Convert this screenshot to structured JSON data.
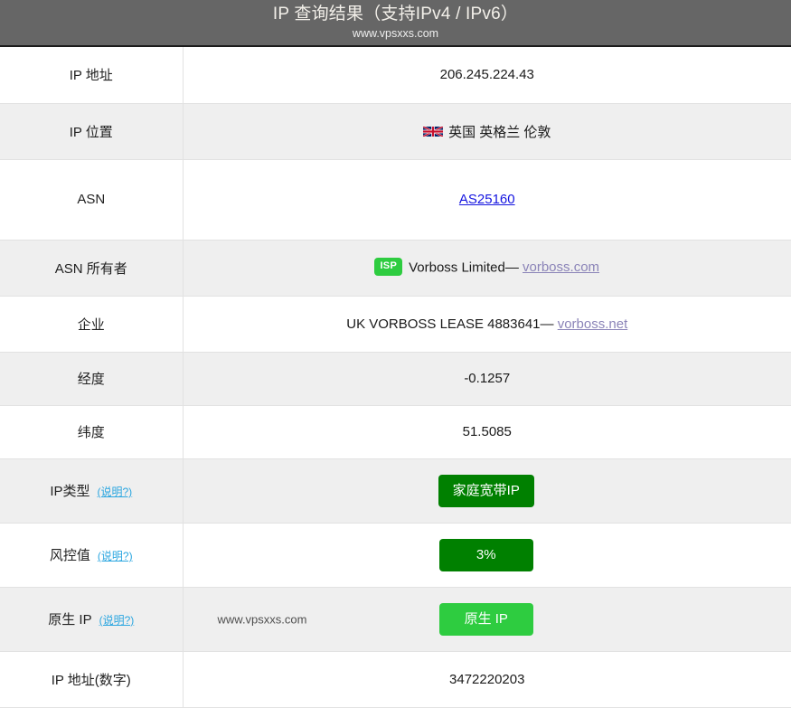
{
  "header": {
    "title": "IP 查询结果（支持IPv4 / IPv6）",
    "subtitle": "www.vpsxxs.com"
  },
  "help_label": "(说明?)",
  "watermark": "www.vpsxxs.com",
  "colors": {
    "header_bg": "#666666",
    "row_alt_bg": "#efefef",
    "badge_dark_green": "#008000",
    "badge_green": "#2ecc40",
    "link_blue": "#1515e0",
    "link_visited": "#8b84b8",
    "help_link_blue": "#2ba6e0"
  },
  "rows": {
    "ip_address": {
      "label": "IP 地址",
      "value": "206.245.224.43"
    },
    "ip_location": {
      "label": "IP 位置",
      "flag": "uk-flag-icon",
      "value": "英国 英格兰 伦敦"
    },
    "asn": {
      "label": "ASN",
      "value": "AS25160"
    },
    "asn_owner": {
      "label": "ASN 所有者",
      "badge": "ISP",
      "value": "Vorboss Limited—",
      "link": "vorboss.com"
    },
    "enterprise": {
      "label": "企业",
      "value": "UK VORBOSS LEASE 4883641—",
      "link": "vorboss.net"
    },
    "longitude": {
      "label": "经度",
      "value": "-0.1257"
    },
    "latitude": {
      "label": "纬度",
      "value": "51.5085"
    },
    "ip_type": {
      "label": "IP类型",
      "value": "家庭宽带IP"
    },
    "risk_value": {
      "label": "风控值",
      "value": "3%"
    },
    "native_ip": {
      "label": "原生 IP",
      "value": "原生 IP"
    },
    "ip_numeric": {
      "label": "IP 地址(数字)",
      "value": "3472220203"
    }
  }
}
